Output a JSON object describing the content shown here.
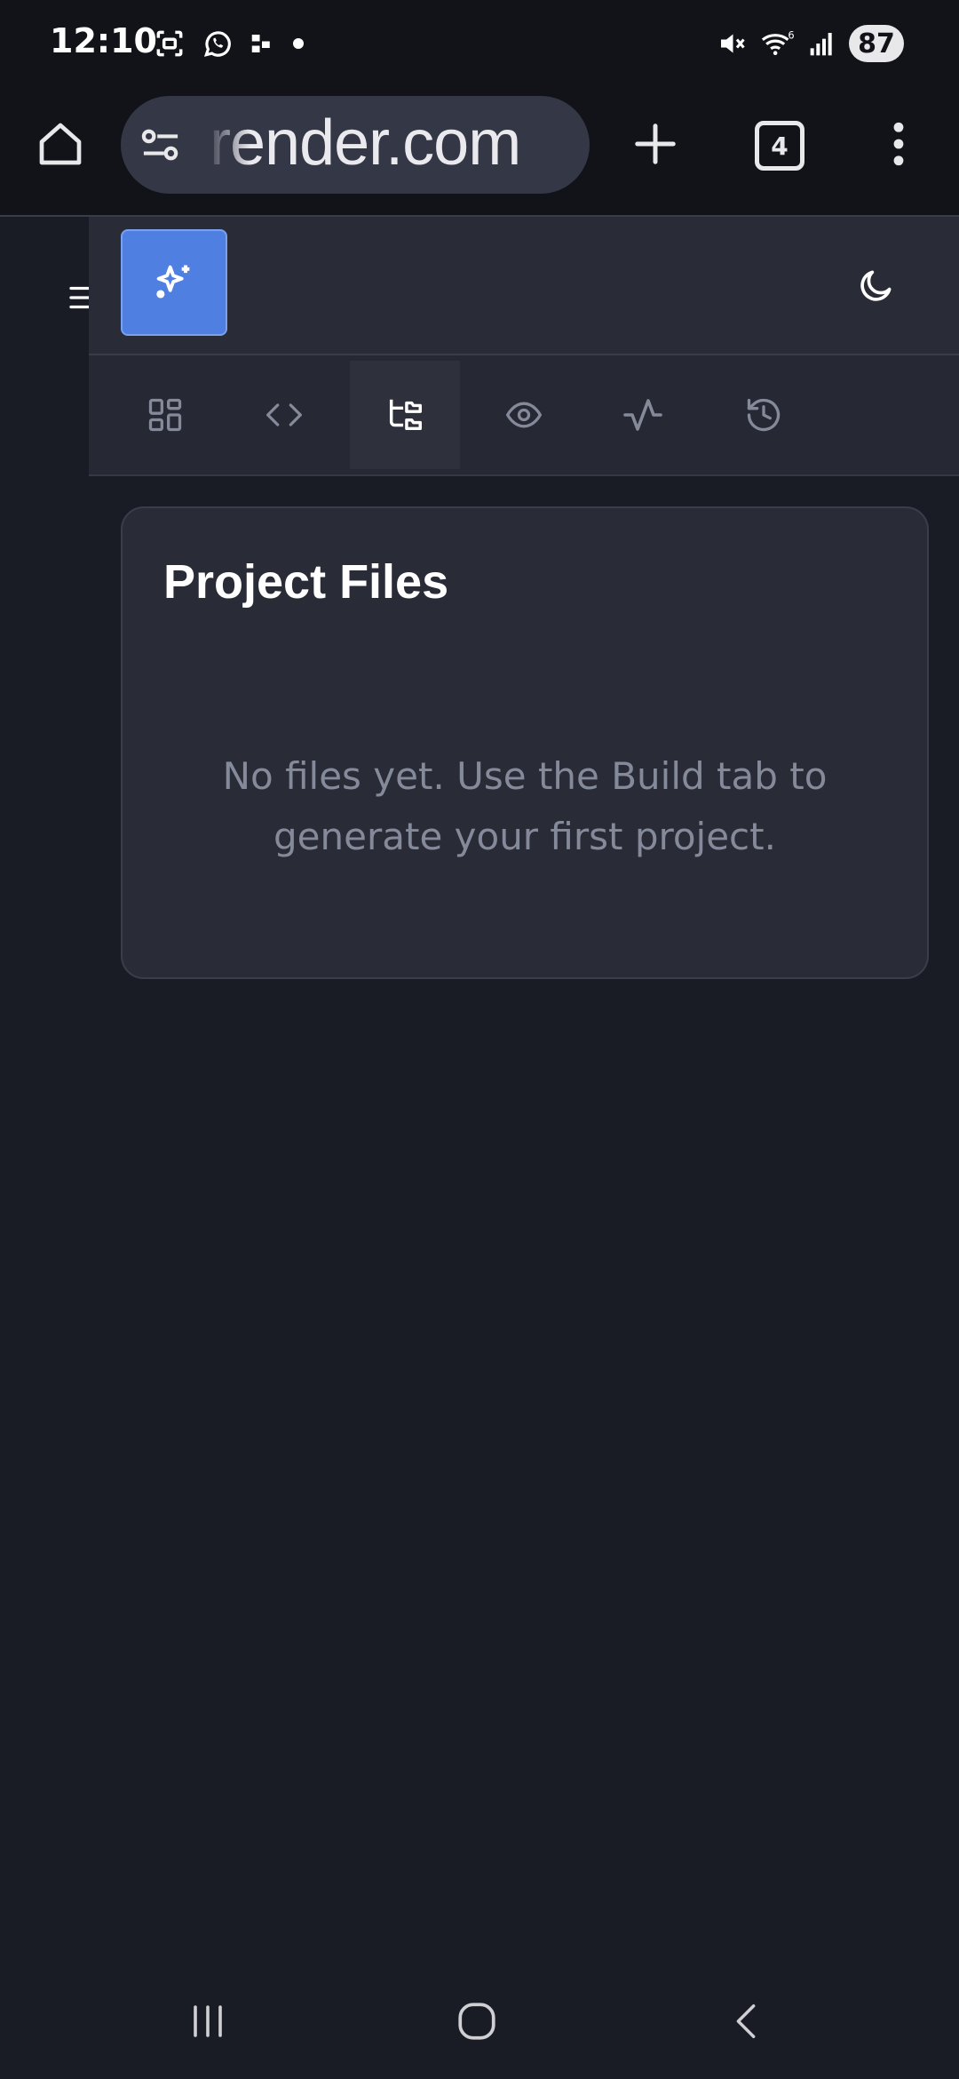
{
  "status_bar": {
    "time": "12:10",
    "battery": "87",
    "wifi_label": "6"
  },
  "browser": {
    "url": "render.com",
    "tab_count": "4"
  },
  "toolbar": {
    "tools": [
      "dashboard",
      "code",
      "files",
      "preview",
      "activity",
      "history"
    ],
    "active": "files"
  },
  "card": {
    "title": "Project Files",
    "empty_line1": "No files yet. Use the Build tab to",
    "empty_line2": "generate your first project."
  },
  "colors": {
    "accent": "#4f7fe1",
    "background": "#191c25",
    "panel": "#292c37",
    "muted_text": "#858a9b"
  }
}
